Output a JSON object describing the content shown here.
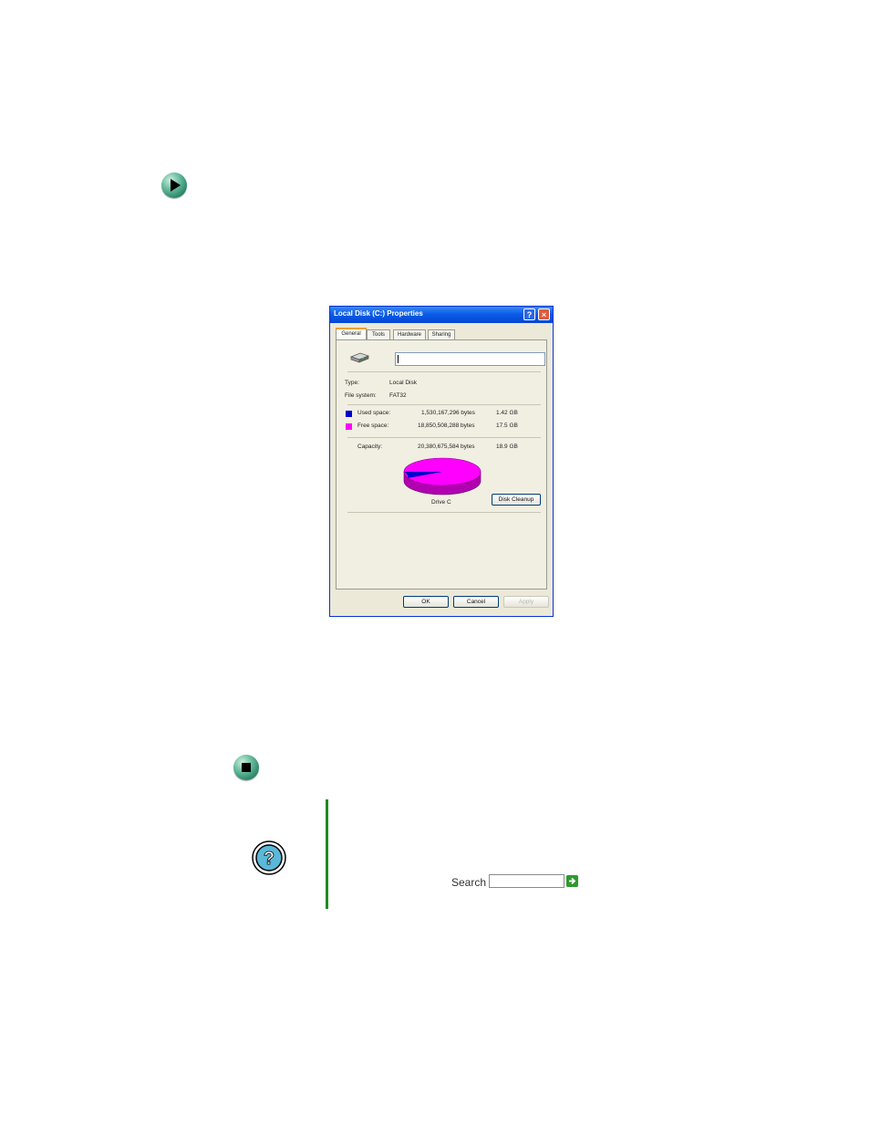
{
  "dialog": {
    "title": "Local Disk (C:) Properties",
    "help_button": "?",
    "close_button": "×",
    "tabs": [
      "General",
      "Tools",
      "Hardware",
      "Sharing"
    ],
    "name_value": "",
    "type_label": "Type:",
    "type_value": "Local Disk",
    "fs_label": "File system:",
    "fs_value": "FAT32",
    "used_label": "Used space:",
    "used_bytes": "1,530,167,296 bytes",
    "used_gb": "1.42 GB",
    "free_label": "Free space:",
    "free_bytes": "18,850,508,288 bytes",
    "free_gb": "17.5 GB",
    "capacity_label": "Capacity:",
    "capacity_bytes": "20,380,675,584 bytes",
    "capacity_gb": "18.9 GB",
    "drive_label": "Drive C",
    "disk_cleanup": "Disk Cleanup",
    "ok": "OK",
    "cancel": "Cancel",
    "apply": "Apply",
    "used_color": "#0000cc",
    "free_color": "#ff00ff",
    "used_fraction": 0.075
  },
  "search": {
    "label": "Search"
  },
  "colors": {
    "accent_green": "#1c8c1c"
  }
}
